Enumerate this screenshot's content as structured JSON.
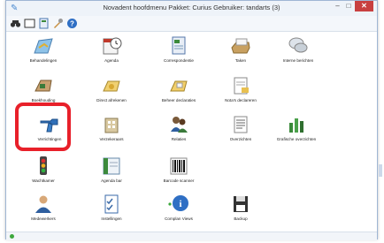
{
  "window": {
    "title": "Novadent hoofdmenu  Pakket: Curius  Gebruiker: tandarts (3)",
    "min_glyph": "–",
    "max_glyph": "□",
    "close_glyph": "✕"
  },
  "toolbar": {
    "buttons": [
      {
        "name": "binoculars-icon",
        "glyph": "👓"
      },
      {
        "name": "window-icon",
        "glyph": "▭"
      },
      {
        "name": "page-icon",
        "glyph": "▦"
      },
      {
        "name": "wrench-icon",
        "glyph": "🔧"
      },
      {
        "name": "help-icon",
        "glyph": "?"
      }
    ]
  },
  "items": [
    {
      "label": "Behandelingen",
      "icon": "treatment-map-icon"
    },
    {
      "label": "Agenda",
      "icon": "agenda-clock-icon"
    },
    {
      "label": "Correspondentie",
      "icon": "correspondence-icon"
    },
    {
      "label": "Taken",
      "icon": "tasks-tray-icon"
    },
    {
      "label": "Interne berichten",
      "icon": "chat-bubbles-icon"
    },
    {
      "label": "Boekhouding",
      "icon": "bookkeeping-icon"
    },
    {
      "label": "Direct afrekenen",
      "icon": "direct-payment-icon"
    },
    {
      "label": "Beheer declaraties",
      "icon": "manage-claims-icon"
    },
    {
      "label": "Nota's declareren",
      "icon": "invoice-claim-icon"
    },
    {
      "label": "Verrichtingen",
      "icon": "drill-icon"
    },
    {
      "label": "Verzekeraars",
      "icon": "insurer-building-icon"
    },
    {
      "label": "Relaties",
      "icon": "relations-people-icon"
    },
    {
      "label": "Overzichten",
      "icon": "overviews-document-icon"
    },
    {
      "label": "Grafische overzichten",
      "icon": "bar-chart-icon"
    },
    {
      "label": "Wachtkamer",
      "icon": "traffic-light-icon"
    },
    {
      "label": "Agenda bar",
      "icon": "agenda-bar-icon"
    },
    {
      "label": "Barcode scanner",
      "icon": "barcode-icon"
    },
    {
      "label": "Medewerkers",
      "icon": "staff-person-icon"
    },
    {
      "label": "Instellingen",
      "icon": "settings-checklist-icon"
    },
    {
      "label": "Complan Views",
      "icon": "info-icon"
    },
    {
      "label": "Backup",
      "icon": "floppy-disk-icon"
    }
  ]
}
